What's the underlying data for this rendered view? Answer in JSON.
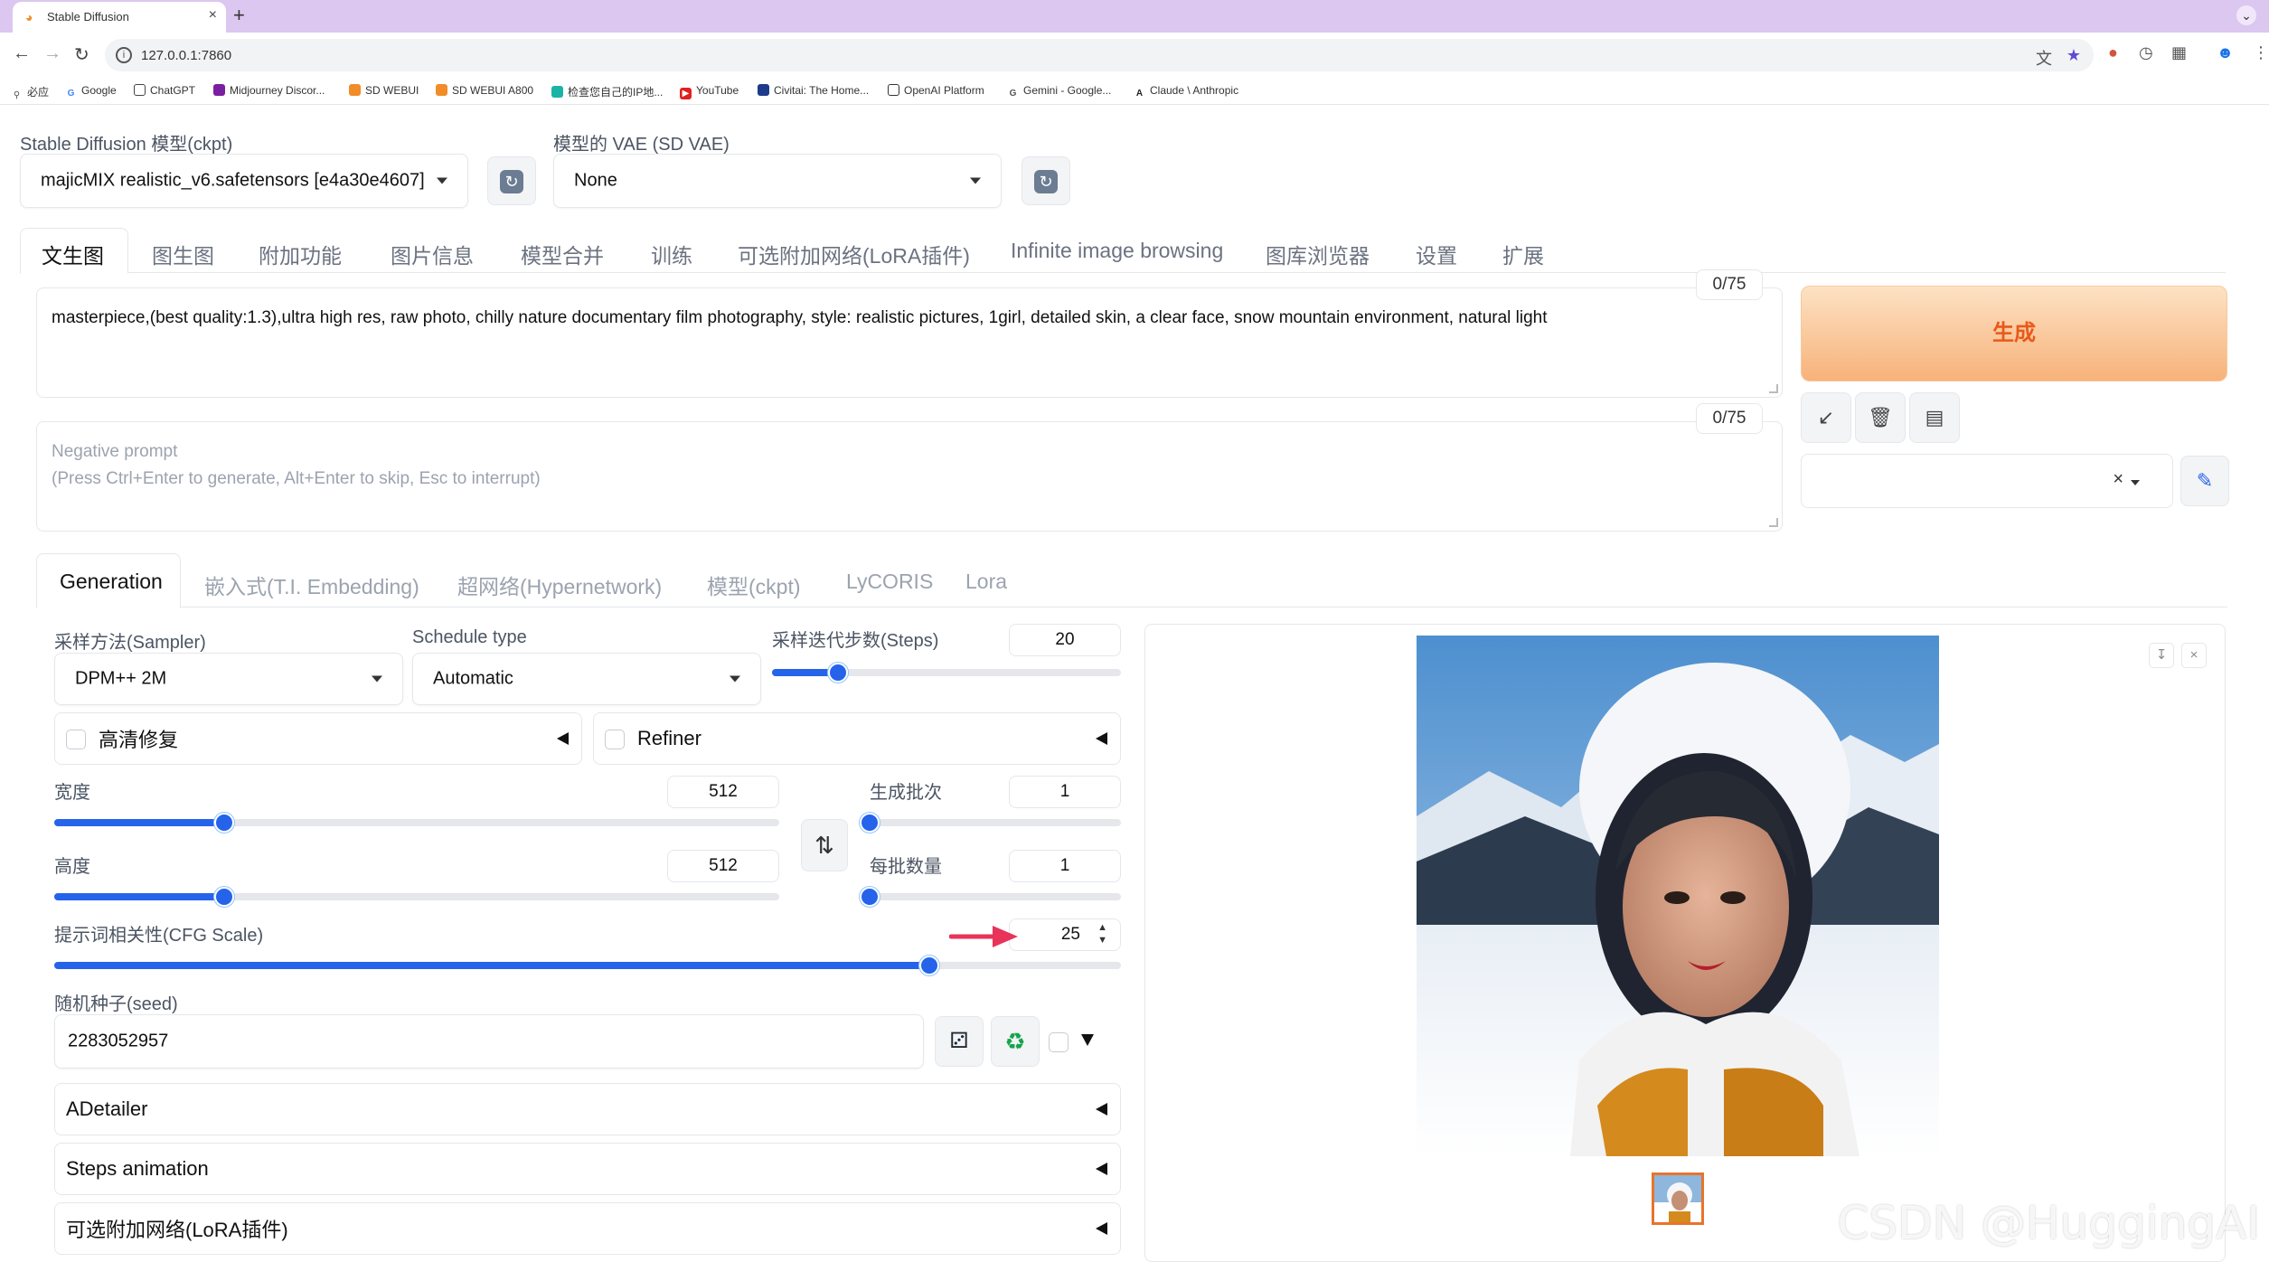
{
  "browser": {
    "tab_title": "Stable Diffusion",
    "url": "127.0.0.1:7860",
    "bookmarks": [
      "必应",
      "Google",
      "ChatGPT",
      "Midjourney Discor...",
      "SD WEBUI",
      "SD WEBUI A800",
      "检查您自己的IP地...",
      "YouTube",
      "Civitai: The Home...",
      "OpenAI Platform",
      "Gemini - Google...",
      "Claude \\ Anthropic"
    ]
  },
  "model": {
    "ckpt_label": "Stable Diffusion 模型(ckpt)",
    "ckpt_value": "majicMIX realistic_v6.safetensors [e4a30e4607]",
    "vae_label": "模型的 VAE (SD VAE)",
    "vae_value": "None"
  },
  "main_tabs": [
    "文生图",
    "图生图",
    "附加功能",
    "图片信息",
    "模型合并",
    "训练",
    "可选附加网络(LoRA插件)",
    "Infinite image browsing",
    "图库浏览器",
    "设置",
    "扩展"
  ],
  "prompt": {
    "text": "masterpiece,(best quality:1.3),ultra high res, raw photo, chilly nature documentary film photography, style: realistic pictures, 1girl, detailed skin, a clear face, snow mountain environment, natural light",
    "counter": "0/75"
  },
  "negative_prompt": {
    "placeholder_line1": "Negative prompt",
    "placeholder_line2": "(Press Ctrl+Enter to generate, Alt+Enter to skip, Esc to interrupt)",
    "counter": "0/75"
  },
  "generate_label": "生成",
  "sub_tabs": [
    "Generation",
    "嵌入式(T.I. Embedding)",
    "超网络(Hypernetwork)",
    "模型(ckpt)",
    "LyCORIS",
    "Lora"
  ],
  "params": {
    "sampler_label": "采样方法(Sampler)",
    "sampler_value": "DPM++ 2M",
    "schedule_label": "Schedule type",
    "schedule_value": "Automatic",
    "steps_label": "采样迭代步数(Steps)",
    "steps_value": "20",
    "steps_fraction": 0.19,
    "hires_label": "高清修复",
    "refiner_label": "Refiner",
    "width_label": "宽度",
    "width_value": "512",
    "width_fraction": 0.235,
    "height_label": "高度",
    "height_value": "512",
    "height_fraction": 0.235,
    "batch_count_label": "生成批次",
    "batch_count_value": "1",
    "batch_count_fraction": 0.0,
    "batch_size_label": "每批数量",
    "batch_size_value": "1",
    "batch_size_fraction": 0.0,
    "cfg_label": "提示词相关性(CFG Scale)",
    "cfg_value": "25",
    "cfg_fraction": 0.82,
    "seed_label": "随机种子(seed)",
    "seed_value": "2283052957"
  },
  "accordions": [
    "ADetailer",
    "Steps animation",
    "可选附加网络(LoRA插件)"
  ],
  "icons": {
    "refresh": "refresh-icon",
    "swap": "swap-icon",
    "dice": "dice-icon",
    "recycle": "recycle-icon",
    "arrow_annotation": "red-arrow-icon"
  },
  "colors": {
    "accent": "#2563eb",
    "generate_text": "#e8591a",
    "arrow": "#e8345a"
  },
  "watermark": "CSDN @HuggingAI"
}
